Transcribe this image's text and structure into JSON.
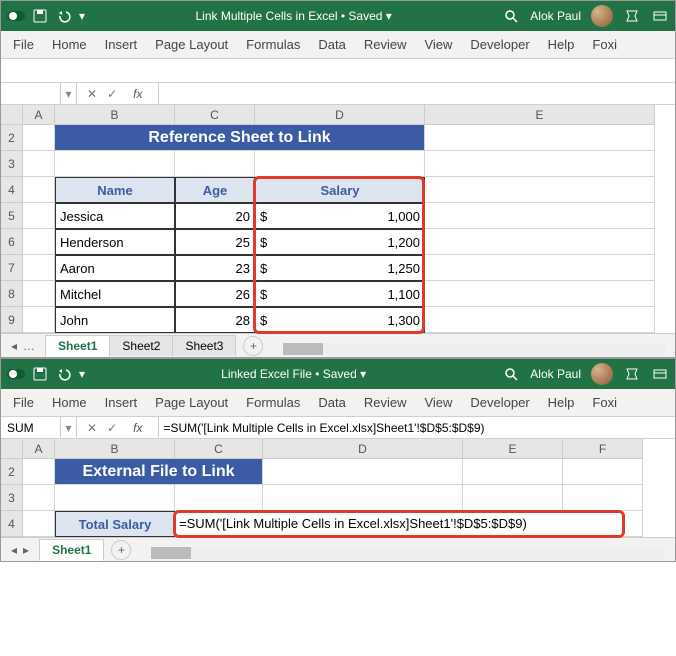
{
  "window1": {
    "title": "Link Multiple Cells in Excel • Saved ▾",
    "user": "Alok Paul",
    "ribbon": [
      "File",
      "Home",
      "Insert",
      "Page Layout",
      "Formulas",
      "Data",
      "Review",
      "View",
      "Developer",
      "Help",
      "Foxi"
    ],
    "name_box": "",
    "fx": "",
    "col_headers": [
      "A",
      "B",
      "C",
      "D",
      "E"
    ],
    "row_headers": [
      "2",
      "3",
      "4",
      "5",
      "6",
      "7",
      "8",
      "9"
    ],
    "banner": "Reference Sheet to Link",
    "table": {
      "headers": [
        "Name",
        "Age",
        "Salary"
      ],
      "rows": [
        {
          "name": "Jessica",
          "age": "20",
          "sal": "1,000"
        },
        {
          "name": "Henderson",
          "age": "25",
          "sal": "1,200"
        },
        {
          "name": "Aaron",
          "age": "23",
          "sal": "1,250"
        },
        {
          "name": "Mitchel",
          "age": "26",
          "sal": "1,100"
        },
        {
          "name": "John",
          "age": "28",
          "sal": "1,300"
        }
      ],
      "currency": "$"
    },
    "sheets": [
      "Sheet1",
      "Sheet2",
      "Sheet3"
    ],
    "active_sheet": "Sheet1"
  },
  "window2": {
    "title": "Linked Excel File • Saved ▾",
    "user": "Alok Paul",
    "ribbon": [
      "File",
      "Home",
      "Insert",
      "Page Layout",
      "Formulas",
      "Data",
      "Review",
      "View",
      "Developer",
      "Help",
      "Foxi"
    ],
    "name_box": "SUM",
    "fx": "=SUM('[Link Multiple Cells in Excel.xlsx]Sheet1'!$D$5:$D$9)",
    "col_headers": [
      "A",
      "B",
      "C",
      "D",
      "E",
      "F"
    ],
    "row_headers": [
      "2",
      "3",
      "4"
    ],
    "banner": "External File to Link",
    "label": "Total Salary",
    "formula_display": "=SUM('[Link Multiple Cells in Excel.xlsx]Sheet1'!$D$5:$D$9)",
    "sheets": [
      "Sheet1"
    ],
    "active_sheet": "Sheet1"
  }
}
